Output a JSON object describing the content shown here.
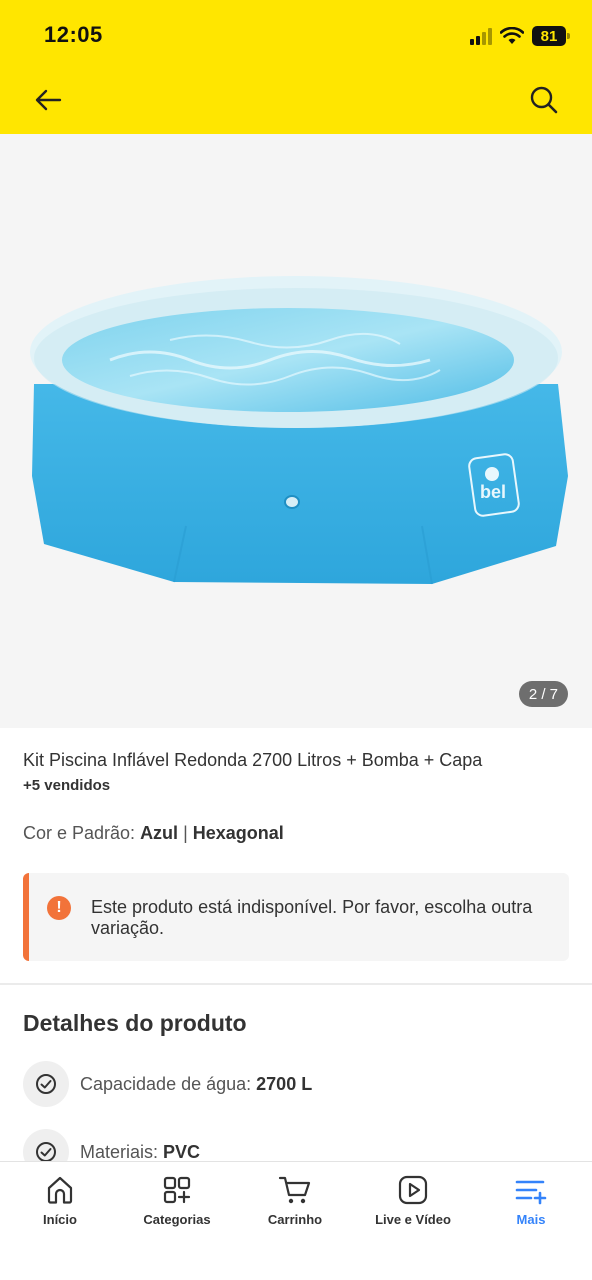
{
  "status_bar": {
    "time": "12:05",
    "battery": "81"
  },
  "gallery": {
    "counter": "2 / 7",
    "logo_text": "bel"
  },
  "product": {
    "title": "Kit Piscina Inflável Redonda 2700 Litros + Bomba + Capa",
    "sold": "+5 vendidos",
    "variation_label": "Cor e Padrão: ",
    "variation_value": "Azul",
    "variation_sep": " | ",
    "variation_value2": "Hexagonal"
  },
  "alert": {
    "icon": "!",
    "text": "Este produto está indisponível. Por favor, escolha outra variação.",
    "color": "#F2733A"
  },
  "details": {
    "title": "Detalhes do produto",
    "specs": [
      {
        "label": "Capacidade de água: ",
        "value": "2700 L",
        "icon": "check-circle-icon"
      },
      {
        "label": "Materiais: ",
        "value": "PVC",
        "icon": "check-circle-icon"
      }
    ]
  },
  "bottom_nav": {
    "items": [
      {
        "label": "Início",
        "icon": "home-icon"
      },
      {
        "label": "Categorias",
        "icon": "categories-icon"
      },
      {
        "label": "Carrinho",
        "icon": "cart-icon"
      },
      {
        "label": "Live e Vídeo",
        "icon": "play-icon"
      },
      {
        "label": "Mais",
        "icon": "more-icon",
        "active": true
      }
    ]
  },
  "colors": {
    "header": "#FFE600",
    "accent": "#3483FA",
    "alert": "#F2733A"
  }
}
